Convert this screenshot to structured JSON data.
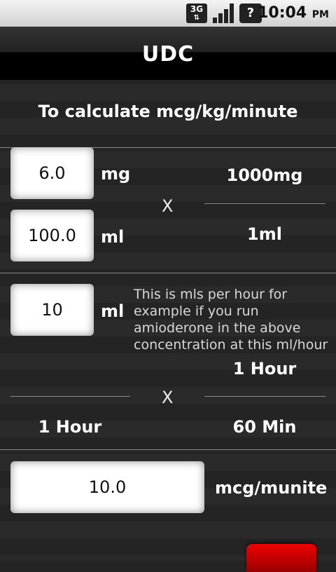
{
  "status": {
    "network": "3G",
    "battery_symbol": "?",
    "time": "10:04",
    "ampm": "PM"
  },
  "app": {
    "title": "UDC"
  },
  "heading": "To calculate mcg/kg/minute",
  "row1": {
    "value": "6.0",
    "unit": "mg",
    "right": "1000mg"
  },
  "row2": {
    "value": "100.0",
    "unit": "ml",
    "right": "1ml"
  },
  "multiply_1": "X",
  "row3": {
    "value": "10",
    "unit": "ml",
    "note": "This is mls per hour for example if you run amioderone in the above concentration at this ml/hour",
    "right": "1 Hour"
  },
  "multiply_2": "X",
  "row4": {
    "left": "1 Hour",
    "right": "60 Min"
  },
  "result": {
    "value": "10.0",
    "unit": "mcg/munite"
  }
}
